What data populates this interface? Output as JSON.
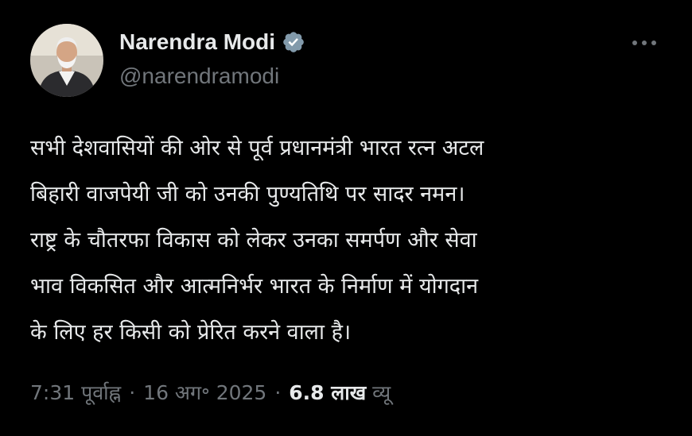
{
  "author": {
    "name": "Narendra Modi",
    "handle": "@narendramodi",
    "verified_color": "#829aab"
  },
  "menu_icon": "more-horizontal-icon",
  "tweet": {
    "lines": [
      "सभी देशवासियों की ओर से पूर्व प्रधानमंत्री भारत रत्न अटल",
      "बिहारी वाजपेयी जी को उनकी पुण्यतिथि पर सादर नमन।",
      "राष्ट्र के चौतरफा विकास को लेकर उनका समर्पण और सेवा",
      "भाव विकसित और आत्मनिर्भर भारत के निर्माण में योगदान",
      "के लिए हर किसी को प्रेरित करने वाला है।"
    ]
  },
  "meta": {
    "time": "7:31 पूर्वाह्न",
    "separator": "·",
    "date": "16 अग॰ 2025",
    "views_count": "6.8 लाख",
    "views_label": "व्यू"
  },
  "colors": {
    "background": "#000000",
    "text_primary": "#e7e9ea",
    "text_secondary": "#71767b"
  }
}
